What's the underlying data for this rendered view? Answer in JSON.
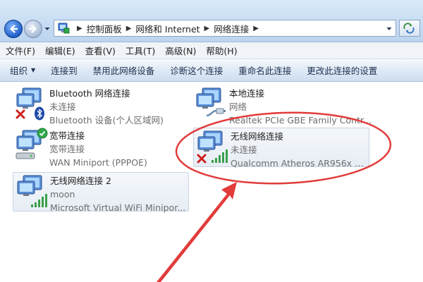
{
  "address_bar": {
    "breadcrumbs": [
      "控制面板",
      "网络和 Internet",
      "网络连接"
    ]
  },
  "menu": {
    "items": [
      "文件(F)",
      "编辑(E)",
      "查看(V)",
      "工具(T)",
      "高级(N)",
      "帮助(H)"
    ]
  },
  "commands": {
    "organize": "组织",
    "connect_to": "连接到",
    "disable": "禁用此网络设备",
    "diagnose": "诊断这个连接",
    "rename": "重命名此连接",
    "change_settings": "更改此连接的设置"
  },
  "connections": {
    "bluetooth": {
      "name": "Bluetooth 网络连接",
      "status": "未连接",
      "device": "Bluetooth 设备(个人区域网)"
    },
    "local": {
      "name": "本地连接",
      "status": "网络",
      "device": "Realtek PCIe GBE Family Contr..."
    },
    "broadband": {
      "name": "宽带连接",
      "status": "宽带连接",
      "device": "WAN Miniport (PPPOE)"
    },
    "wireless": {
      "name": "无线网络连接",
      "status": "未连接",
      "device": "Qualcomm Atheros AR956x Wi..."
    },
    "wireless2": {
      "name": "无线网络连接 2",
      "status": "moon",
      "device": "Microsoft Virtual WiFi Minipor..."
    }
  },
  "colors": {
    "annotation_red": "#e23b3b",
    "selection_bg": "#eaeff5",
    "toolbar_text": "#1e3050"
  }
}
